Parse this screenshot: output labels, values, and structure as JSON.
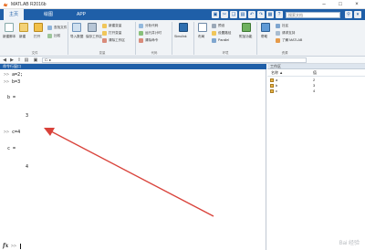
{
  "window": {
    "title": "MATLAB R2016b"
  },
  "tabs": [
    {
      "label": "主页"
    },
    {
      "label": "绘图"
    },
    {
      "label": "APP"
    }
  ],
  "search": {
    "placeholder": "搜索文档"
  },
  "ribbon": {
    "file": {
      "new_script": "新建脚本",
      "new": "新建",
      "open": "打开",
      "find_files": "查找文件",
      "compare": "比较",
      "group_label": "文件"
    },
    "variable": {
      "import_data": "导入数据",
      "save_workspace": "保存工作区",
      "new_variable": "新建变量",
      "open_variable": "打开变量",
      "clear_workspace": "清除工作区",
      "group_label": "变量"
    },
    "code": {
      "analyze_code": "分析代码",
      "run_and_time": "运行并计时",
      "clear_commands": "清除命令",
      "group_label": "代码"
    },
    "simulink": {
      "label": "Simulink"
    },
    "environment": {
      "layout": "布局",
      "preferences": "预设",
      "set_path": "设置路径",
      "parallel": "Parallel",
      "addons": "附加功能",
      "group_label": "环境"
    },
    "resources": {
      "help": "帮助",
      "community": "社区",
      "request_support": "请求支持",
      "learn_matlab": "了解 MATLAB",
      "group_label": "资源"
    }
  },
  "address": {
    "path": "C: ▸"
  },
  "command_window": {
    "title": "命令行窗口",
    "lines": [
      {
        "prompt": ">>",
        "text": "a=2;"
      },
      {
        "prompt": ">>",
        "text": "b=3"
      },
      {
        "prompt": "",
        "text": "b ="
      },
      {
        "prompt": "",
        "text": "3"
      },
      {
        "prompt": ">>",
        "text": "c=4"
      },
      {
        "prompt": "",
        "text": "c ="
      },
      {
        "prompt": "",
        "text": "4"
      }
    ],
    "fx_prompt": ">>"
  },
  "workspace": {
    "title": "工作区",
    "col_name": "名称 ▲",
    "col_value": "值",
    "variables": [
      {
        "name": "a",
        "value": "2"
      },
      {
        "name": "b",
        "value": "3"
      },
      {
        "name": "c",
        "value": "4"
      }
    ]
  },
  "watermark": "Bai 经验",
  "colors": {
    "accent": "#1f5fa8",
    "arrow": "#d9423a"
  }
}
